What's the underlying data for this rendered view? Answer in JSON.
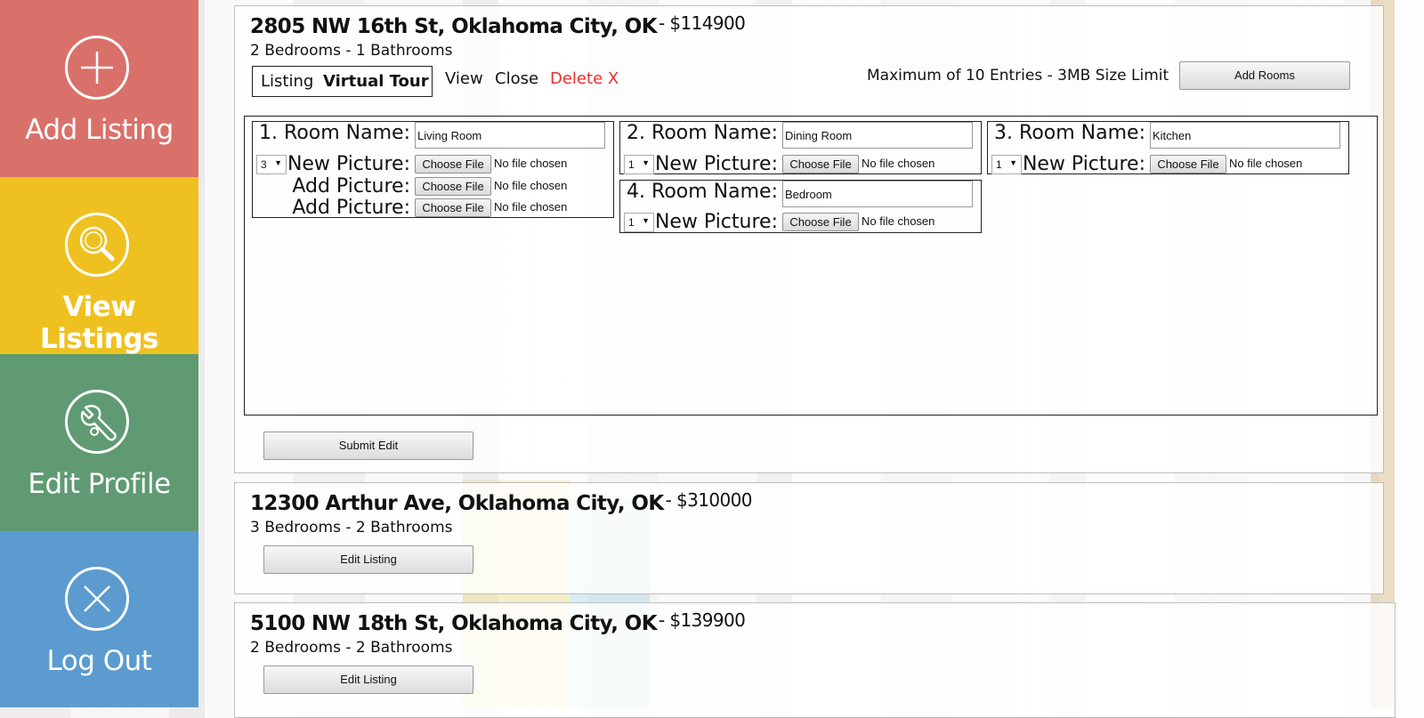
{
  "sidebar": {
    "items": [
      {
        "label": "Add Listing",
        "icon": "plus-icon",
        "color": "#d9716a"
      },
      {
        "label": "View Listings",
        "icon": "magnifier-icon",
        "color": "#efc120"
      },
      {
        "label": "Edit Profile",
        "icon": "wrench-icon",
        "color": "#5f9a72"
      },
      {
        "label": "Log Out",
        "icon": "close-icon",
        "color": "#5b9bd0"
      }
    ]
  },
  "listings": [
    {
      "address": "2805 NW 16th St, Oklahoma City, OK",
      "price_prefix": "- ",
      "price": "$114900",
      "details": "2 Bedrooms - 1 Bathrooms",
      "tabs": {
        "listing": "Listing",
        "virtual_tour": "Virtual Tour"
      },
      "actions": {
        "view": "View",
        "close": "Close",
        "delete": "Delete X"
      },
      "max_note": "Maximum of 10 Entries - 3MB Size Limit",
      "add_rooms_label": "Add Rooms",
      "submit_label": "Submit Edit",
      "rooms": [
        {
          "room_label": "1. Room Name:",
          "room_name": "Living Room",
          "count": "3",
          "pictures": [
            {
              "label": "New Picture:",
              "button": "Choose File",
              "status": "No file chosen"
            },
            {
              "label": "Add Picture:",
              "button": "Choose File",
              "status": "No file chosen"
            },
            {
              "label": "Add Picture:",
              "button": "Choose File",
              "status": "No file chosen"
            }
          ]
        },
        {
          "room_label": "2. Room Name:",
          "room_name": "Dining Room",
          "count": "1",
          "pictures": [
            {
              "label": "New Picture:",
              "button": "Choose File",
              "status": "No file chosen"
            }
          ]
        },
        {
          "room_label": "3. Room Name:",
          "room_name": "Kitchen",
          "count": "1",
          "pictures": [
            {
              "label": "New Picture:",
              "button": "Choose File",
              "status": "No file chosen"
            }
          ]
        },
        {
          "room_label": "4. Room Name:",
          "room_name": "Bedroom",
          "count": "1",
          "pictures": [
            {
              "label": "New Picture:",
              "button": "Choose File",
              "status": "No file chosen"
            }
          ]
        }
      ],
      "delete_color": "#e83030"
    },
    {
      "address": "12300 Arthur Ave, Oklahoma City, OK",
      "price_prefix": "- ",
      "price": "$310000",
      "details": "3 Bedrooms - 2 Bathrooms",
      "edit_label": "Edit Listing"
    },
    {
      "address": "5100 NW 18th St, Oklahoma City, OK",
      "price_prefix": "- ",
      "price": "$139900",
      "details": "2 Bedrooms - 2 Bathrooms",
      "edit_label": "Edit Listing"
    }
  ]
}
